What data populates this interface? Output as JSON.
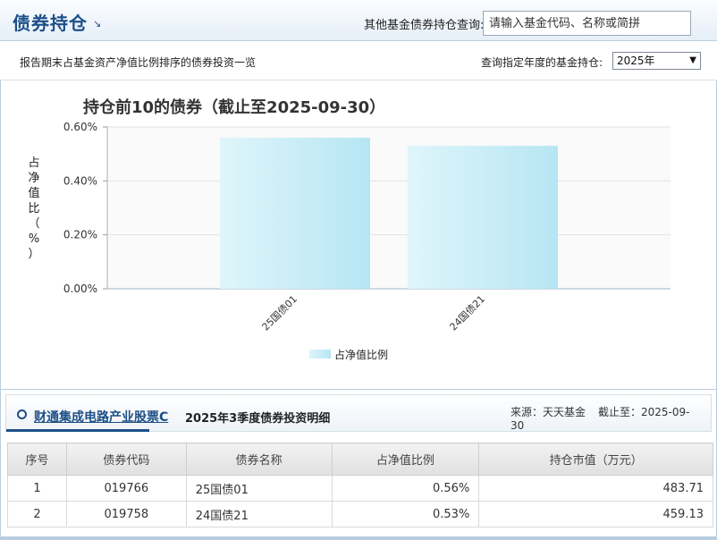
{
  "header": {
    "title": "债券持仓",
    "corner_icon": "expand-arrow",
    "query_label": "其他基金债券持仓查询:",
    "search_placeholder": "请输入基金代码、名称或简拼"
  },
  "subbar": {
    "description": "报告期末占基金资产净值比例排序的债券投资一览",
    "year_label": "查询指定年度的基金持仓:",
    "year_selected": "2025年"
  },
  "chart_data": {
    "type": "bar",
    "title": "持仓前10的债券（截止至2025-09-30）",
    "ylabel": "占净值比（%）",
    "ylabel_chars": [
      "占",
      "净",
      "值",
      "比",
      "（",
      "%",
      "）"
    ],
    "categories": [
      "25国债01",
      "24国债21"
    ],
    "series": [
      {
        "name": "占净值比例",
        "values": [
          0.56,
          0.53
        ]
      }
    ],
    "ylim": [
      0,
      0.6
    ],
    "yticks": [
      "0.00%",
      "0.20%",
      "0.40%",
      "0.60%"
    ],
    "ytick_values": [
      0,
      0.2,
      0.4,
      0.6
    ],
    "grid": true,
    "legend": "bottom-center",
    "bar_color": "#c9eef8"
  },
  "detail": {
    "fund_name": "财通集成电路产业股票C",
    "subtitle": "2025年3季度债券投资明细",
    "source": "来源：天天基金",
    "as_of": "截止至：2025-09-30",
    "columns": [
      "序号",
      "债券代码",
      "债券名称",
      "占净值比例",
      "持仓市值（万元）"
    ],
    "rows": [
      [
        "1",
        "019766",
        "25国债01",
        "0.56%",
        "483.71"
      ],
      [
        "2",
        "019758",
        "24国债21",
        "0.53%",
        "459.13"
      ]
    ]
  }
}
